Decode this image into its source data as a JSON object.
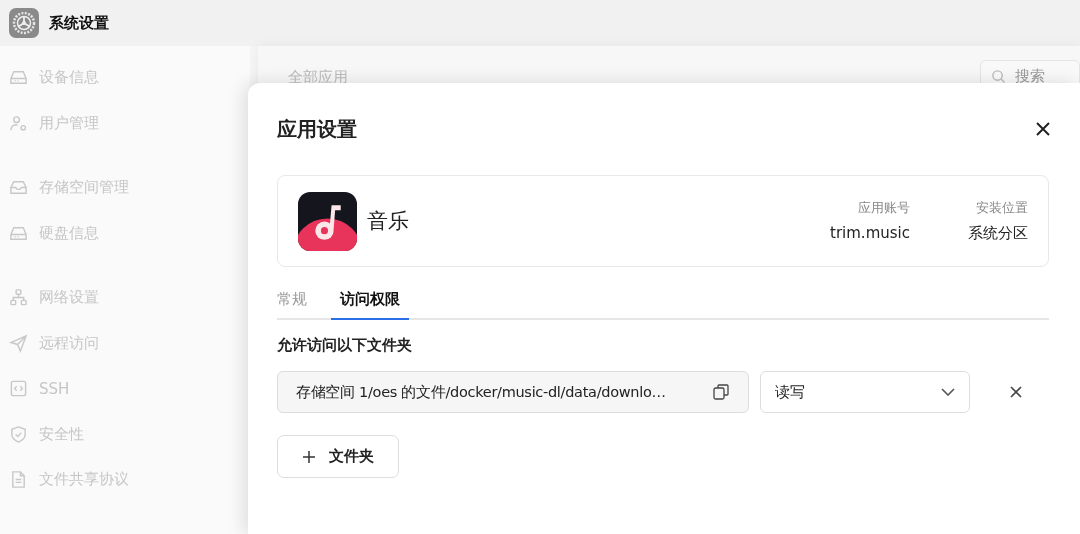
{
  "window": {
    "title": "系统设置"
  },
  "sidebar": {
    "groups": [
      [
        {
          "label": "设备信息",
          "kind": "drive"
        },
        {
          "label": "用户管理",
          "kind": "user"
        }
      ],
      [
        {
          "label": "存储空间管理",
          "kind": "inbox"
        },
        {
          "label": "硬盘信息",
          "kind": "drive"
        }
      ],
      [
        {
          "label": "网络设置",
          "kind": "network"
        },
        {
          "label": "远程访问",
          "kind": "send"
        },
        {
          "label": "SSH",
          "kind": "code"
        },
        {
          "label": "安全性",
          "kind": "shield"
        },
        {
          "label": "文件共享协议",
          "kind": "file"
        }
      ]
    ]
  },
  "background_panel": {
    "title": "全部应用",
    "search": {
      "placeholder": "搜索"
    }
  },
  "dialog": {
    "title": "应用设置",
    "app": {
      "name": "音乐",
      "fields": [
        {
          "label": "应用账号",
          "value": "trim.music"
        },
        {
          "label": "安装位置",
          "value": "系统分区"
        }
      ]
    },
    "tabs": [
      {
        "label": "常规",
        "selected": false
      },
      {
        "label": "访问权限",
        "selected": true
      }
    ],
    "section_title": "允许访问以下文件夹",
    "folders": [
      {
        "path": "存储空间 1/oes 的文件/docker/music-dl/data/downlo…",
        "permission": "读写"
      }
    ],
    "add_button": "文件夹"
  }
}
